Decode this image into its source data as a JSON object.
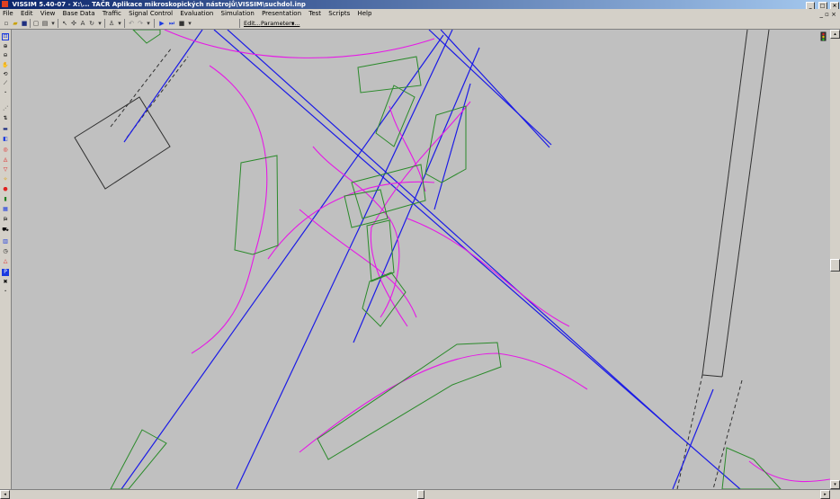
{
  "window": {
    "title": "VISSIM 5.40-07 - X:\\... TAČR Aplikace mikroskopických nástrojů\\VISSIM\\suchdol.inp",
    "minimize_glyph": "_",
    "maximize_glyph": "□",
    "close_glyph": "×"
  },
  "menu": {
    "items": [
      "File",
      "Edit",
      "View",
      "Base Data",
      "Traffic",
      "Signal Control",
      "Evaluation",
      "Simulation",
      "Presentation",
      "Test",
      "Scripts",
      "Help"
    ],
    "mdi_controls": "_ ▫ ×"
  },
  "toolbar": {
    "edit_label": "Edit...",
    "parameters_label": "Parameters...",
    "dropdown_glyph": "▾"
  },
  "colors": {
    "link": "#1a1ae6",
    "connector": "#e619e6",
    "area": "#2a8a2a",
    "outline": "#303030"
  },
  "scrollbars": {
    "left_arrow": "◂",
    "right_arrow": "▸",
    "up_arrow": "▴",
    "down_arrow": "▾"
  }
}
